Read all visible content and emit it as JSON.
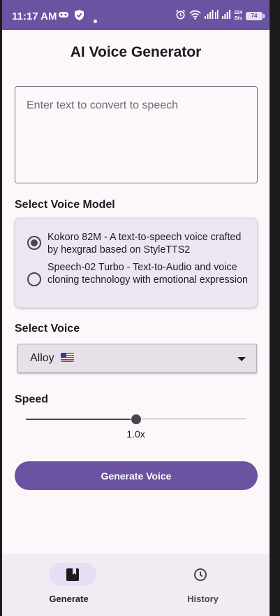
{
  "status_bar": {
    "time": "11:17 AM",
    "net_speed_value": "224",
    "net_speed_unit": "B/s",
    "battery": "74"
  },
  "page": {
    "title": "AI Voice Generator"
  },
  "text_input": {
    "placeholder": "Enter text to convert to speech",
    "value": ""
  },
  "voice_model": {
    "label": "Select Voice Model",
    "options": [
      {
        "label": "Kokoro 82M - A text-to-speech voice crafted by hexgrad based on StyleTTS2",
        "selected": true
      },
      {
        "label": "Speech-02 Turbo - Text-to-Audio and voice cloning technology with emotional expression",
        "selected": false
      }
    ]
  },
  "voice": {
    "label": "Select Voice",
    "selected": "Alloy",
    "flag_icon": "us-flag-icon"
  },
  "speed": {
    "label": "Speed",
    "value_text": "1.0x",
    "slider_fraction": 0.5
  },
  "generate_button": {
    "label": "Generate Voice"
  },
  "bottom_nav": {
    "items": [
      {
        "label": "Generate",
        "icon": "bookmark-box-icon",
        "active": true
      },
      {
        "label": "History",
        "icon": "clock-icon",
        "active": false
      }
    ]
  },
  "colors": {
    "primary": "#6a54a2",
    "background": "#fdf7fb",
    "card": "#ece6f1"
  }
}
